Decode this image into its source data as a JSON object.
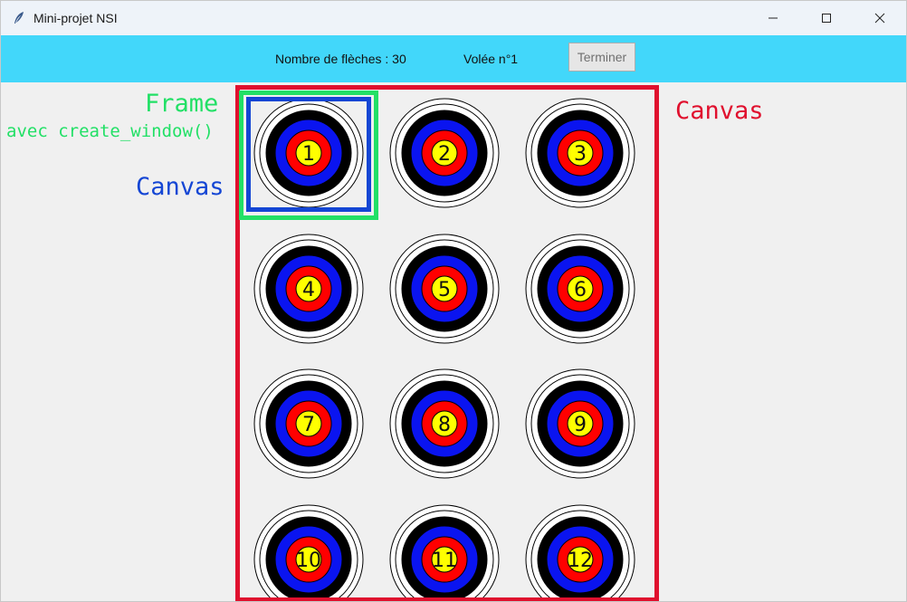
{
  "window": {
    "title": "Mini-projet NSI",
    "icon": "feather-icon",
    "controls": [
      "minimize-icon",
      "maximize-icon",
      "close-icon"
    ]
  },
  "toolbar": {
    "arrows_label": "Nombre de flèches : 30",
    "volley_label": "Volée n°1",
    "finish_label": "Terminer"
  },
  "annotations": {
    "frame": "Frame",
    "frame_sub": "avec create_window()",
    "canvas_inner": "Canvas",
    "canvas_outer": "Canvas"
  },
  "colors": {
    "toolbar_bg": "#42d7fa",
    "frame_annotation": "#22e066",
    "inner_canvas_annotation": "#1446d4",
    "outer_canvas_annotation": "#e0102e",
    "ring_white": "#ffffff",
    "ring_black": "#000000",
    "ring_blue": "#0a14f0",
    "ring_red": "#ff0000",
    "ring_yellow": "#ffff00"
  },
  "targets": [
    "1",
    "2",
    "3",
    "4",
    "5",
    "6",
    "7",
    "8",
    "9",
    "10",
    "11",
    "12"
  ]
}
